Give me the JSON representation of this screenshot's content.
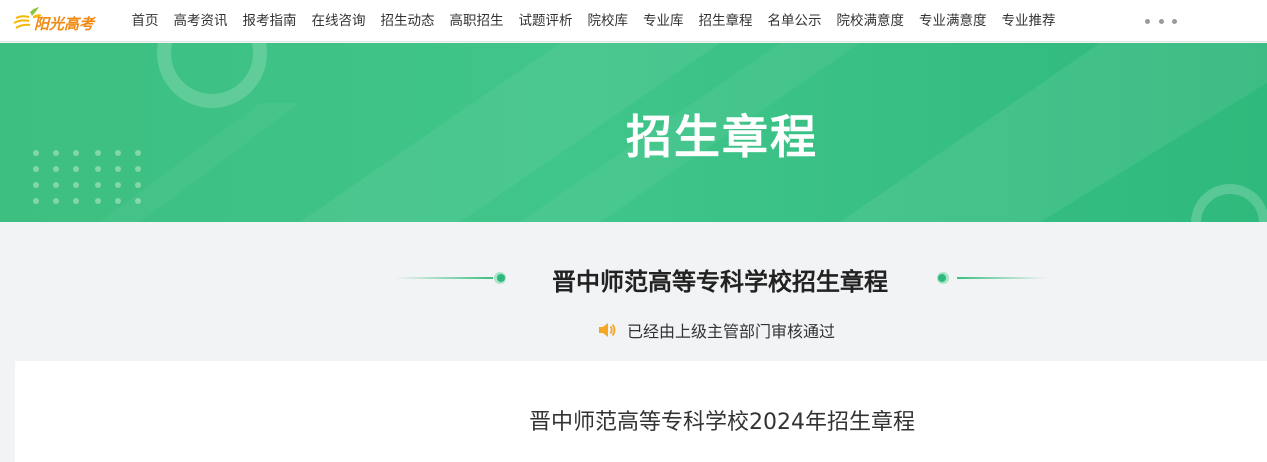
{
  "header": {
    "logo_text": "阳光高考",
    "nav_items": [
      "首页",
      "高考资讯",
      "报考指南",
      "在线咨询",
      "招生动态",
      "高职招生",
      "试题评析",
      "院校库",
      "专业库",
      "招生章程",
      "名单公示",
      "院校满意度",
      "专业满意度",
      "专业推荐"
    ],
    "more_icon": "more-dots-icon"
  },
  "banner": {
    "title": "招生章程"
  },
  "article": {
    "title": "晋中师范高等专科学校招生章程",
    "verify_text": "已经由上级主管部门审核通过",
    "verify_icon": "speaker-icon",
    "content_heading": "晋中师范高等专科学校2024年招生章程"
  },
  "colors": {
    "accent_green": "#3dbf81",
    "logo_orange": "#f08a12",
    "speaker_orange": "#f5a623"
  }
}
